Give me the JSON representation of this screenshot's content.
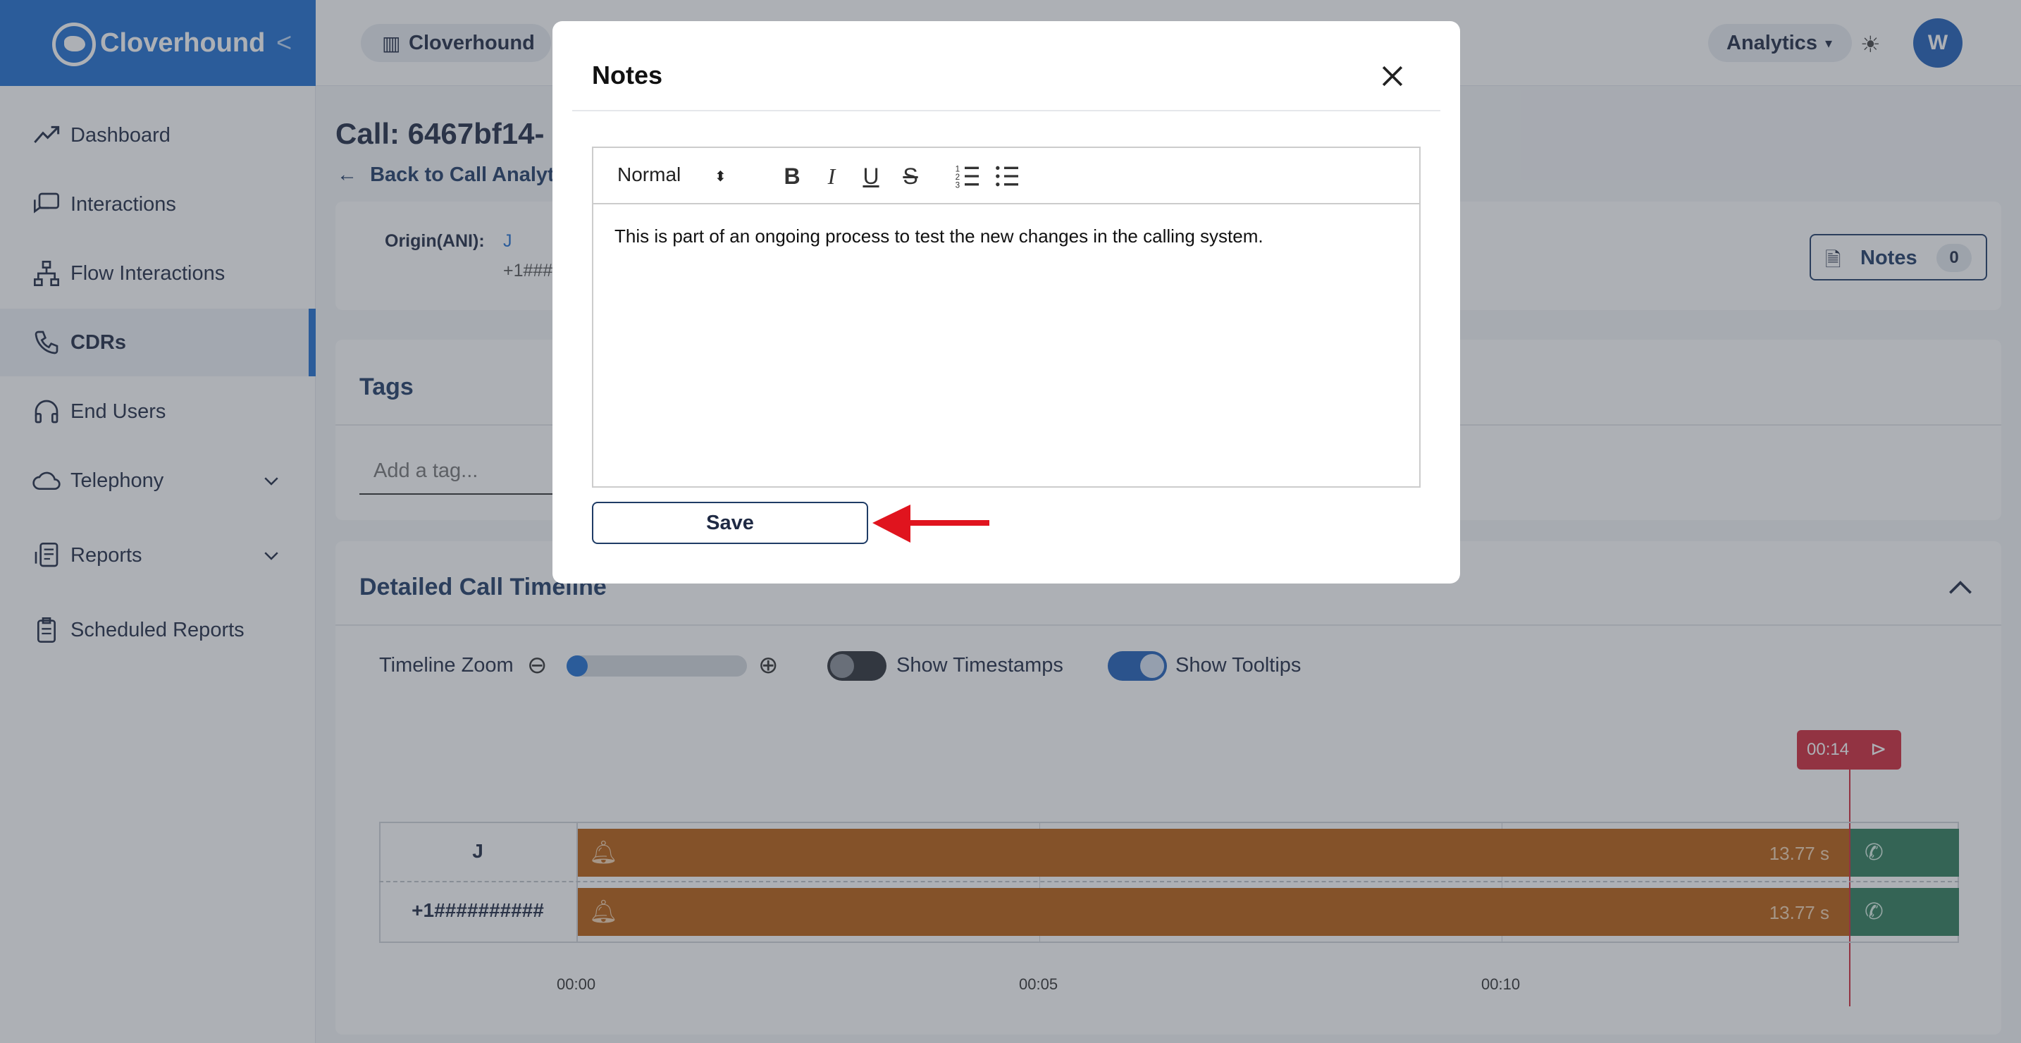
{
  "brand": {
    "name": "Cloverhound"
  },
  "sidebar": {
    "items": [
      {
        "label": "Dashboard",
        "icon": "trend-up-icon"
      },
      {
        "label": "Interactions",
        "icon": "chat-bubbles-icon"
      },
      {
        "label": "Flow Interactions",
        "icon": "flow-tree-icon"
      },
      {
        "label": "CDRs",
        "icon": "phone-icon"
      },
      {
        "label": "End Users",
        "icon": "headset-icon"
      },
      {
        "label": "Telephony",
        "icon": "cloud-phone-icon"
      },
      {
        "label": "Reports",
        "icon": "report-phone-icon"
      },
      {
        "label": "Scheduled Reports",
        "icon": "clipboard-icon"
      }
    ]
  },
  "topbar": {
    "org": "Cloverhound",
    "analytics": "Analytics",
    "avatar": "W"
  },
  "page": {
    "title": "Call: 6467bf14-",
    "back_link": "Back to Call Analyti",
    "origin_label": "Origin(ANI):",
    "origin_name": "J",
    "origin_number": "+1###",
    "notes_label": "Notes",
    "notes_count": "0"
  },
  "tags": {
    "title": "Tags",
    "placeholder": "Add a tag..."
  },
  "timeline": {
    "title": "Detailed Call Timeline",
    "zoom_label": "Timeline Zoom",
    "zoom_value": 0.0,
    "show_timestamps_label": "Show Timestamps",
    "show_timestamps": false,
    "show_tooltips_label": "Show Tooltips",
    "show_tooltips": true,
    "marker": "00:14",
    "rows": [
      {
        "label": "J",
        "duration": "13.77 s"
      },
      {
        "label": "+1##########",
        "duration": "13.77 s"
      }
    ],
    "ticks": [
      "00:00",
      "00:05",
      "00:10"
    ],
    "colors": {
      "ringing": "#b85d0f",
      "connected": "#2f7d5b",
      "marker": "#d1283a"
    }
  },
  "modal": {
    "title": "Notes",
    "format_select": "Normal",
    "text": "This is part of an ongoing process to test the new changes in the calling system.",
    "save_label": "Save"
  },
  "colors": {
    "brand": "#1f6fd0",
    "accent_arrow": "#e0141e"
  }
}
